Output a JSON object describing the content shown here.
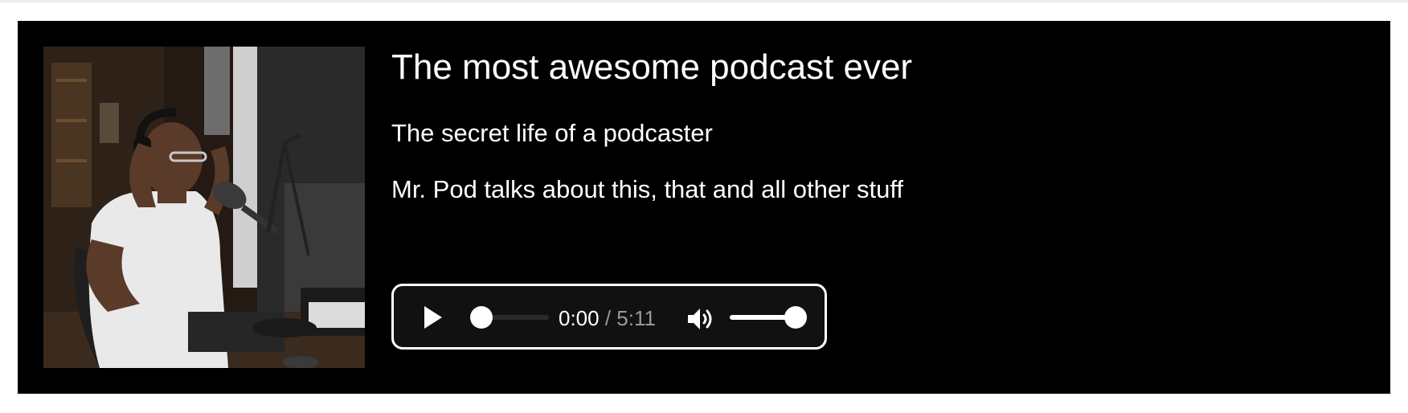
{
  "episode": {
    "title": "The most awesome podcast ever",
    "subtitle": "The secret life of a podcaster",
    "description": "Mr. Pod talks about this, that and all other stuff",
    "cover_image": "photo of a man wearing headphones speaking into a studio microphone"
  },
  "player": {
    "current_time": "0:00",
    "separator": " / ",
    "duration": "5:11",
    "progress": 0.0,
    "volume": 1.0,
    "play_icon": "play-icon",
    "volume_icon": "speaker-icon"
  },
  "colors": {
    "card_background": "#000000",
    "text": "#ffffff",
    "player_background": "#111111",
    "player_border": "#ffffff",
    "muted_text": "#9a9a9a"
  }
}
